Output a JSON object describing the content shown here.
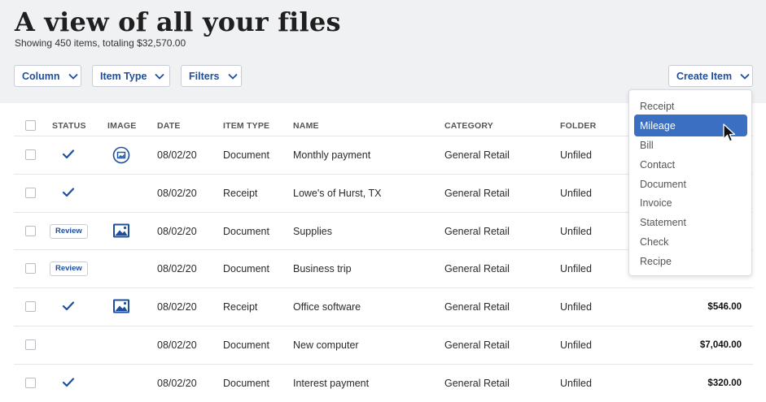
{
  "header": {
    "title": "A view of all your files",
    "subtitle": "Showing 450 items, totaling $32,570.00"
  },
  "toolbar": {
    "column_label": "Column",
    "item_type_label": "Item Type",
    "filters_label": "Filters",
    "create_item_label": "Create Item"
  },
  "table": {
    "headers": {
      "status": "STATUS",
      "image": "IMAGE",
      "date": "DATE",
      "item_type": "ITEM TYPE",
      "name": "NAME",
      "category": "CATEGORY",
      "folder": "FOLDER"
    },
    "rows": [
      {
        "status": "check",
        "image": "image-circle-icon",
        "date": "08/02/20",
        "item_type": "Document",
        "name": "Monthly payment",
        "category": "General Retail",
        "folder": "Unfiled",
        "amount": ""
      },
      {
        "status": "check",
        "image": "",
        "date": "08/02/20",
        "item_type": "Receipt",
        "name": "Lowe's of Hurst, TX",
        "category": "General Retail",
        "folder": "Unfiled",
        "amount": ""
      },
      {
        "status": "Review",
        "image": "image-icon",
        "date": "08/02/20",
        "item_type": "Document",
        "name": "Supplies",
        "category": "General Retail",
        "folder": "Unfiled",
        "amount": ""
      },
      {
        "status": "Review",
        "image": "",
        "date": "08/02/20",
        "item_type": "Document",
        "name": "Business trip",
        "category": "General Retail",
        "folder": "Unfiled",
        "amount": ""
      },
      {
        "status": "check",
        "image": "image-icon",
        "date": "08/02/20",
        "item_type": "Receipt",
        "name": "Office software",
        "category": "General Retail",
        "folder": "Unfiled",
        "amount": "$546.00"
      },
      {
        "status": "",
        "image": "",
        "date": "08/02/20",
        "item_type": "Document",
        "name": "New computer",
        "category": "General Retail",
        "folder": "Unfiled",
        "amount": "$7,040.00"
      },
      {
        "status": "check",
        "image": "",
        "date": "08/02/20",
        "item_type": "Document",
        "name": "Interest payment",
        "category": "General Retail",
        "folder": "Unfiled",
        "amount": "$320.00"
      }
    ]
  },
  "create_menu": {
    "items": [
      "Receipt",
      "Mileage",
      "Bill",
      "Contact",
      "Document",
      "Invoice",
      "Statement",
      "Check",
      "Recipe"
    ],
    "highlighted": "Mileage"
  },
  "colors": {
    "accent": "#1d4f9e",
    "highlight": "#3b6fc2",
    "header_bg": "#f0f1f3"
  }
}
